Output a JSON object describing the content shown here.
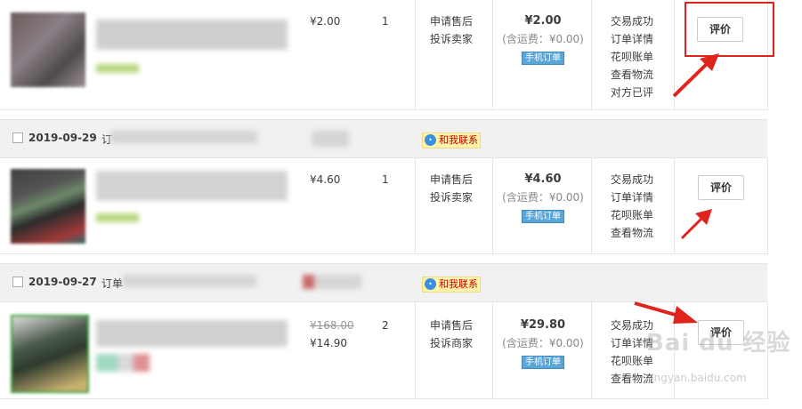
{
  "orders": [
    {
      "date": "",
      "order_label": "",
      "contact": "",
      "price": "¥2.00",
      "original_price": "",
      "qty": "1",
      "service": [
        "申请售后",
        "投诉卖家"
      ],
      "total": "¥2.00",
      "shipping": "(含运费：¥0.00)",
      "mobile_tag": "手机订单",
      "status": [
        "交易成功",
        "订单详情",
        "花呗账单",
        "查看物流",
        "对方已评"
      ],
      "review_button": "评价"
    },
    {
      "date": "2019-09-29",
      "order_label": "订",
      "contact": "和我联系",
      "price": "¥4.60",
      "original_price": "",
      "qty": "1",
      "service": [
        "申请售后",
        "投诉卖家"
      ],
      "total": "¥4.60",
      "shipping": "(含运费：¥0.00)",
      "mobile_tag": "手机订单",
      "status": [
        "交易成功",
        "订单详情",
        "花呗账单",
        "查看物流"
      ],
      "review_button": "评价"
    },
    {
      "date": "2019-09-27",
      "order_label": "订单",
      "contact": "和我联系",
      "price": "¥14.90",
      "original_price": "¥168.00",
      "qty": "2",
      "service": [
        "申请售后",
        "投诉商家"
      ],
      "total": "¥29.80",
      "shipping": "(含运费：¥0.00)",
      "mobile_tag": "手机订单",
      "status": [
        "交易成功",
        "订单详情",
        "花呗账单",
        "查看物流"
      ],
      "review_button": "评价"
    }
  ],
  "watermark": {
    "logo": "Bai du 经验",
    "url": "jingyan.baidu.com"
  },
  "colors": {
    "highlight": "#e0231b",
    "header_bg": "#f1f1f1",
    "mobile_tag": "#5aa6d8",
    "contact_badge": "#fff3a8"
  }
}
